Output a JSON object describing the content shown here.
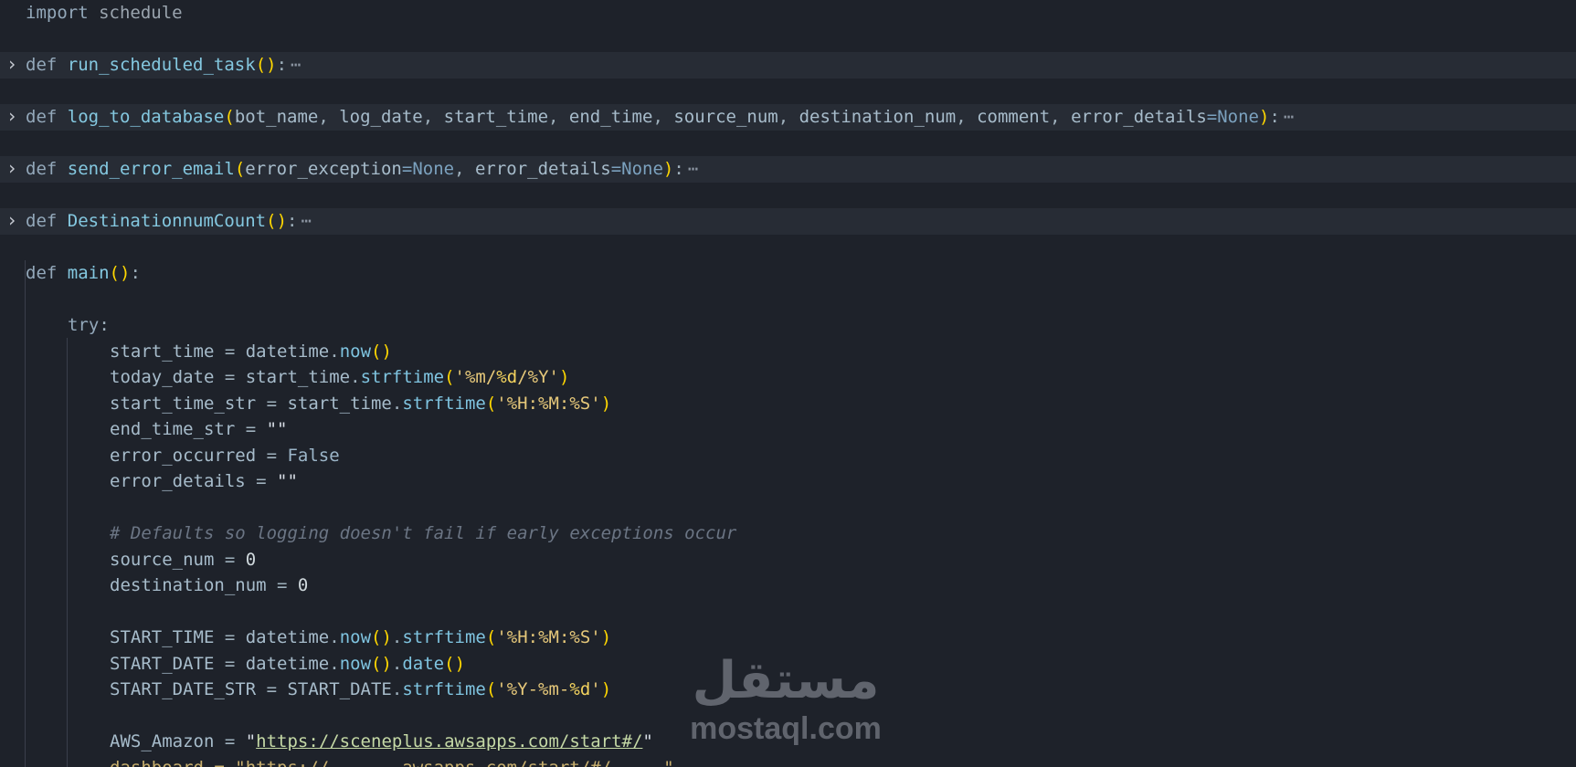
{
  "editor": {
    "theme_colors": {
      "background": "#1e222a",
      "folded_line_background": "#272c35",
      "keyword": "#56b6c2",
      "function_name": "#84c8e0",
      "bracket": "#ffd700",
      "string": "#e6c87a",
      "comment": "#6b7584"
    },
    "lines": {
      "l1": {
        "kw": "import",
        "mod": "schedule"
      },
      "l3": {
        "kw": "def",
        "name": "run_scheduled_task",
        "tail": ":",
        "ellipsis": "⋯"
      },
      "l5": {
        "kw": "def",
        "name": "log_to_database",
        "p1": "bot_name",
        "p2": "log_date",
        "p3": "start_time",
        "p4": "end_time",
        "p5": "source_num",
        "p6": "destination_num",
        "p7": "comment",
        "p8": "error_details",
        "eq": "=",
        "none": "None",
        "tail": ":",
        "ellipsis": "⋯"
      },
      "l7": {
        "kw": "def",
        "name": "send_error_email",
        "p1": "error_exception",
        "eq": "=",
        "none1": "None",
        "p2": "error_details",
        "none2": "None",
        "tail": ":",
        "ellipsis": "⋯"
      },
      "l9": {
        "kw": "def",
        "name": "DestinationnumCount",
        "tail": ":",
        "ellipsis": "⋯"
      },
      "l11": {
        "kw": "def",
        "name": "main",
        "tail": ":"
      },
      "l13": {
        "kw": "try",
        "tail": ":"
      },
      "l14": {
        "var": "start_time",
        "op": " = ",
        "obj": "datetime",
        "fn": "now"
      },
      "l15": {
        "var": "today_date",
        "op": " = ",
        "obj": "start_time",
        "fn": "strftime",
        "s1": "'%m/",
        "s2": "%d",
        "s3": "/%Y'"
      },
      "l16": {
        "var": "start_time_str",
        "op": " = ",
        "obj": "start_time",
        "fn": "strftime",
        "s1": "'%H:%M:%S'"
      },
      "l17": {
        "var": "end_time_str",
        "op": " = ",
        "str": "\"\""
      },
      "l18": {
        "var": "error_occurred",
        "op": " = ",
        "bool": "False"
      },
      "l19": {
        "var": "error_details",
        "op": " = ",
        "str": "\"\""
      },
      "l21": {
        "comment": "# Defaults so logging doesn't fail if early exceptions occur"
      },
      "l22": {
        "var": "source_num",
        "op": " = ",
        "num": "0"
      },
      "l23": {
        "var": "destination_num",
        "op": " = ",
        "num": "0"
      },
      "l25": {
        "var": "START_TIME",
        "op": " = ",
        "obj": "datetime",
        "fn1": "now",
        "fn2": "strftime",
        "s1": "'%H:%M:%S'"
      },
      "l26": {
        "var": "START_DATE",
        "op": " = ",
        "obj": "datetime",
        "fn1": "now",
        "fn2": "date"
      },
      "l27": {
        "var": "START_DATE_STR",
        "op": " = ",
        "obj": "START_DATE",
        "fn": "strftime",
        "s1": "'%Y-%m-",
        "s2": "%d",
        "s3": "'"
      },
      "l29": {
        "var": "AWS_Amazon",
        "op": " = ",
        "q": "\"",
        "url": "https://sceneplus.awsapps.com/start#/"
      },
      "l30": {
        "partial": "dashboard = \"https://... ...awsapps.com/start/#/ ... \""
      }
    }
  },
  "watermark": {
    "arabic": "مستقل",
    "latin": "mostaql.com"
  }
}
